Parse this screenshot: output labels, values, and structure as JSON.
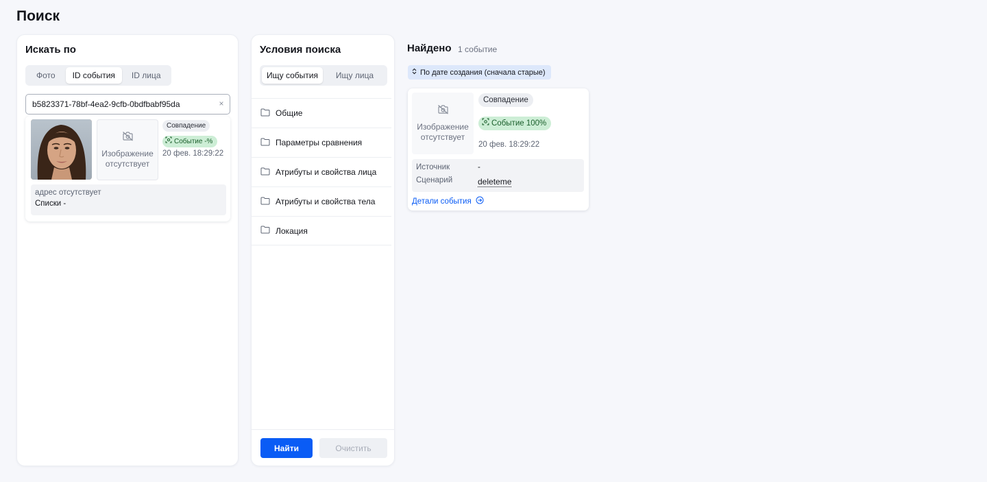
{
  "page_title": "Поиск",
  "search_by": {
    "title": "Искать по",
    "tabs": [
      {
        "label": "Фото",
        "active": false
      },
      {
        "label": "ID события",
        "active": true
      },
      {
        "label": "ID лица",
        "active": false
      }
    ],
    "id_input_value": "b5823371-78bf-4ea2-9cfb-0bdfbabf95da",
    "clear_glyph": "×",
    "result": {
      "no_image_line1": "Изображение",
      "no_image_line2": "отсутствует",
      "match_label": "Совпадение",
      "event_badge": "Событие -%",
      "timestamp": "20 фев. 18:29:22",
      "address": "адрес отсутствует",
      "lists_label": "Списки",
      "lists_value": "-"
    }
  },
  "conditions": {
    "title": "Условия поиска",
    "tabs": [
      {
        "label": "Ищу события",
        "active": true
      },
      {
        "label": "Ищу лица",
        "active": false
      }
    ],
    "folders": [
      "Общие",
      "Параметры сравнения",
      "Атрибуты и свойства лица",
      "Атрибуты и свойства тела",
      "Локация"
    ],
    "find_button": "Найти",
    "clear_button": "Очистить"
  },
  "found": {
    "title": "Найдено",
    "count": "1 событие",
    "sort_label": "По дате создания (сначала старые)",
    "card": {
      "no_image_line1": "Изображение",
      "no_image_line2": "отсутствует",
      "match_label": "Совпадение",
      "event_badge": "Событие 100%",
      "timestamp": "20 фев. 18:29:22",
      "source_label": "Источник",
      "source_value": "-",
      "scenario_label": "Сценарий",
      "scenario_value": "deleteme",
      "details_link": "Детали события"
    }
  },
  "colors": {
    "accent": "#0a5cf5",
    "background": "#f6f7fb",
    "match_green": "#cdeed6",
    "sort_chip": "#dde8fb"
  },
  "icons": {
    "no_image": "camera-off-icon",
    "folder": "folder-icon",
    "sort": "sort-arrows-icon",
    "details": "arrow-circle-right-icon",
    "face_scan": "face-scan-icon"
  }
}
